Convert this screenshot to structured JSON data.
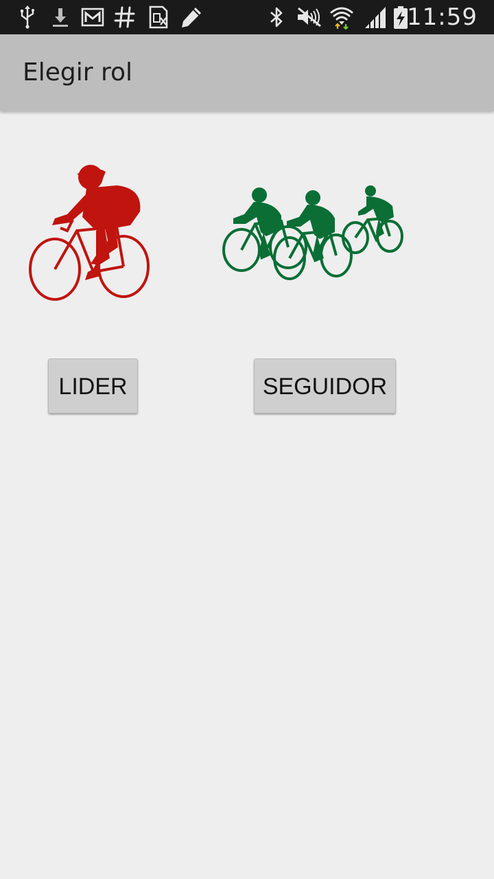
{
  "status_bar": {
    "time": "11:59",
    "icons": [
      "usb-icon",
      "download-icon",
      "gmail-icon",
      "hash-icon",
      "sim-icon",
      "pencil-icon",
      "bluetooth-icon",
      "mute-icon",
      "wifi-icon",
      "signal-icon",
      "battery-charging-icon"
    ]
  },
  "action_bar": {
    "title": "Elegir rol"
  },
  "roles": {
    "lider": {
      "button_label": "LIDER",
      "image_icon": "single-cyclist-icon",
      "image_color": "#c0140f"
    },
    "seguidor": {
      "button_label": "SEGUIDOR",
      "image_icon": "group-cyclists-icon",
      "image_color": "#0a6e35"
    }
  },
  "colors": {
    "background": "#eeeeee",
    "status_bar": "#1a1a1a",
    "action_bar": "#bdbdbd",
    "button": "#cfcfcf"
  }
}
